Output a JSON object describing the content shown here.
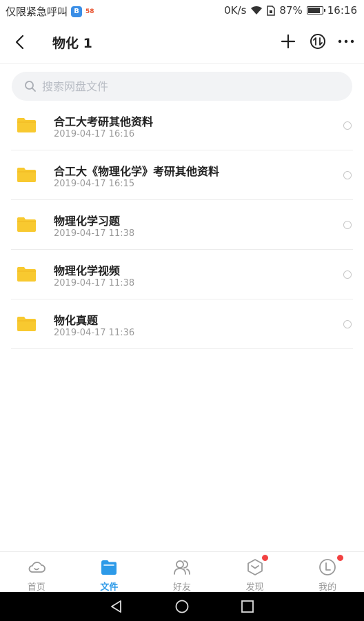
{
  "status_bar": {
    "carrier": "仅限紧急呼叫",
    "badge1": "B",
    "badge2": "58",
    "speed": "0K/s",
    "battery_percent": "87%",
    "battery_level": 0.87,
    "time": "16:16"
  },
  "header": {
    "title": "物化 1"
  },
  "search": {
    "placeholder": "搜索网盘文件",
    "value": ""
  },
  "files": [
    {
      "name": "合工大考研其他资料",
      "date": "2019-04-17  16:16"
    },
    {
      "name": "合工大《物理化学》考研其他资料",
      "date": "2019-04-17  16:15"
    },
    {
      "name": "物理化学习题",
      "date": "2019-04-17  11:38"
    },
    {
      "name": "物理化学视频",
      "date": "2019-04-17  11:38"
    },
    {
      "name": "物化真题",
      "date": "2019-04-17  11:36"
    }
  ],
  "tabs": [
    {
      "label": "首页",
      "icon": "cloud-icon",
      "active": false,
      "dot": false
    },
    {
      "label": "文件",
      "icon": "folder-icon",
      "active": true,
      "dot": false
    },
    {
      "label": "好友",
      "icon": "friends-icon",
      "active": false,
      "dot": false
    },
    {
      "label": "发现",
      "icon": "discover-icon",
      "active": false,
      "dot": true
    },
    {
      "label": "我的",
      "icon": "profile-icon",
      "active": false,
      "dot": true
    }
  ],
  "colors": {
    "accent": "#2d9ae8",
    "folder": "#f8c930",
    "badge_red": "#f24141"
  }
}
